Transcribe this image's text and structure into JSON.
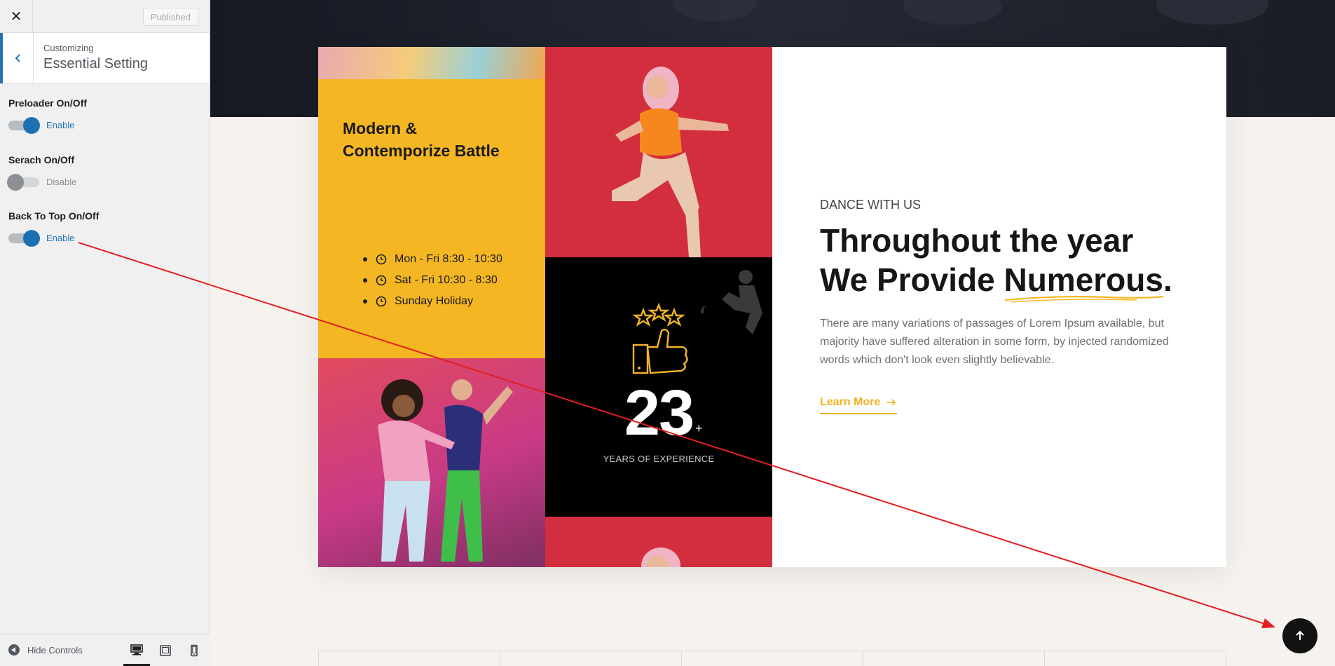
{
  "sidebar": {
    "close_label": "✕",
    "publish_label": "Published",
    "section_sub": "Customizing",
    "section_title": "Essential Setting",
    "controls": [
      {
        "label": "Preloader On/Off",
        "state": "Enable",
        "on": true
      },
      {
        "label": "Serach On/Off",
        "state": "Disable",
        "on": false
      },
      {
        "label": "Back To Top On/Off",
        "state": "Enable",
        "on": true
      }
    ],
    "footer": {
      "hide_label": "Hide Controls"
    }
  },
  "preview": {
    "battle_title": "Modern & Contemporize Battle",
    "schedule": [
      "Mon - Fri 8:30 - 10:30",
      "Sat - Fri 10:30 - 8:30",
      "Sunday Holiday"
    ],
    "experience": {
      "number": "23",
      "plus": "+",
      "label": "YEARS OF EXPERIENCE"
    },
    "eyebrow": "DANCE WITH US",
    "headline_line1": "Throughout the year",
    "headline_line2_pre": "We Provide ",
    "headline_highlight": "Numerous",
    "headline_line2_post": ".",
    "description": "There are many variations of passages of Lorem Ipsum available, but majority have suffered alteration in some form, by injected randomized words which don't look even slightly believable.",
    "learn_more": "Learn More"
  },
  "colors": {
    "accent": "#f4b623",
    "link_blue": "#2271b1",
    "annotation": "#e21f1f"
  }
}
